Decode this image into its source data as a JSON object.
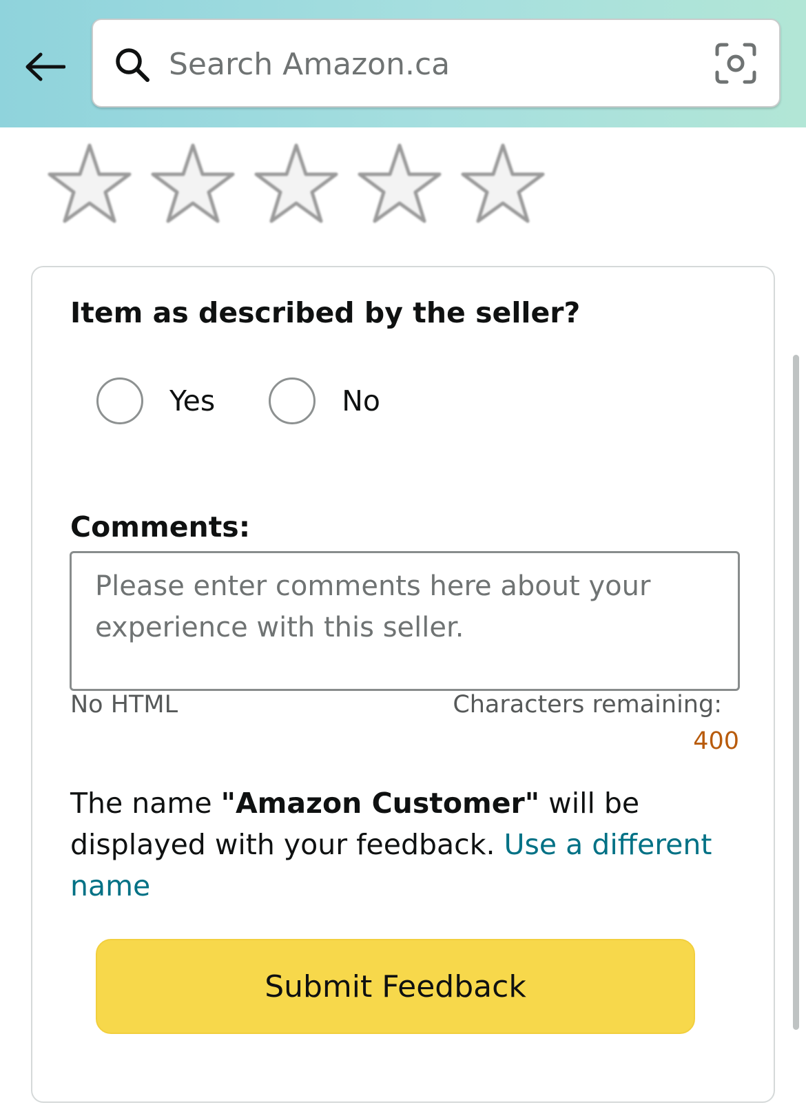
{
  "header": {
    "search_placeholder": "Search Amazon.ca"
  },
  "rating": {
    "max_stars": 5,
    "selected": 0
  },
  "feedback_form": {
    "question": "Item as described by the seller?",
    "options": [
      "Yes",
      "No"
    ],
    "comments_label": "Comments:",
    "comments_placeholder": "Please enter comments here about your experience with this seller.",
    "comments_value": "",
    "no_html_note": "No HTML",
    "chars_remaining_label": "Characters remaining:",
    "chars_remaining_value": "400",
    "display_name_prefix": "The name ",
    "display_name": "\"Amazon Customer\"",
    "display_name_suffix": " will be displayed with your feedback. ",
    "change_name_link": "Use a different name",
    "submit_label": "Submit Feedback"
  },
  "colors": {
    "header_gradient_start": "#8fd3dc",
    "header_gradient_end": "#b2e6d6",
    "submit_button": "#f7d84b",
    "link": "#007185",
    "counter": "#b85b0c"
  }
}
